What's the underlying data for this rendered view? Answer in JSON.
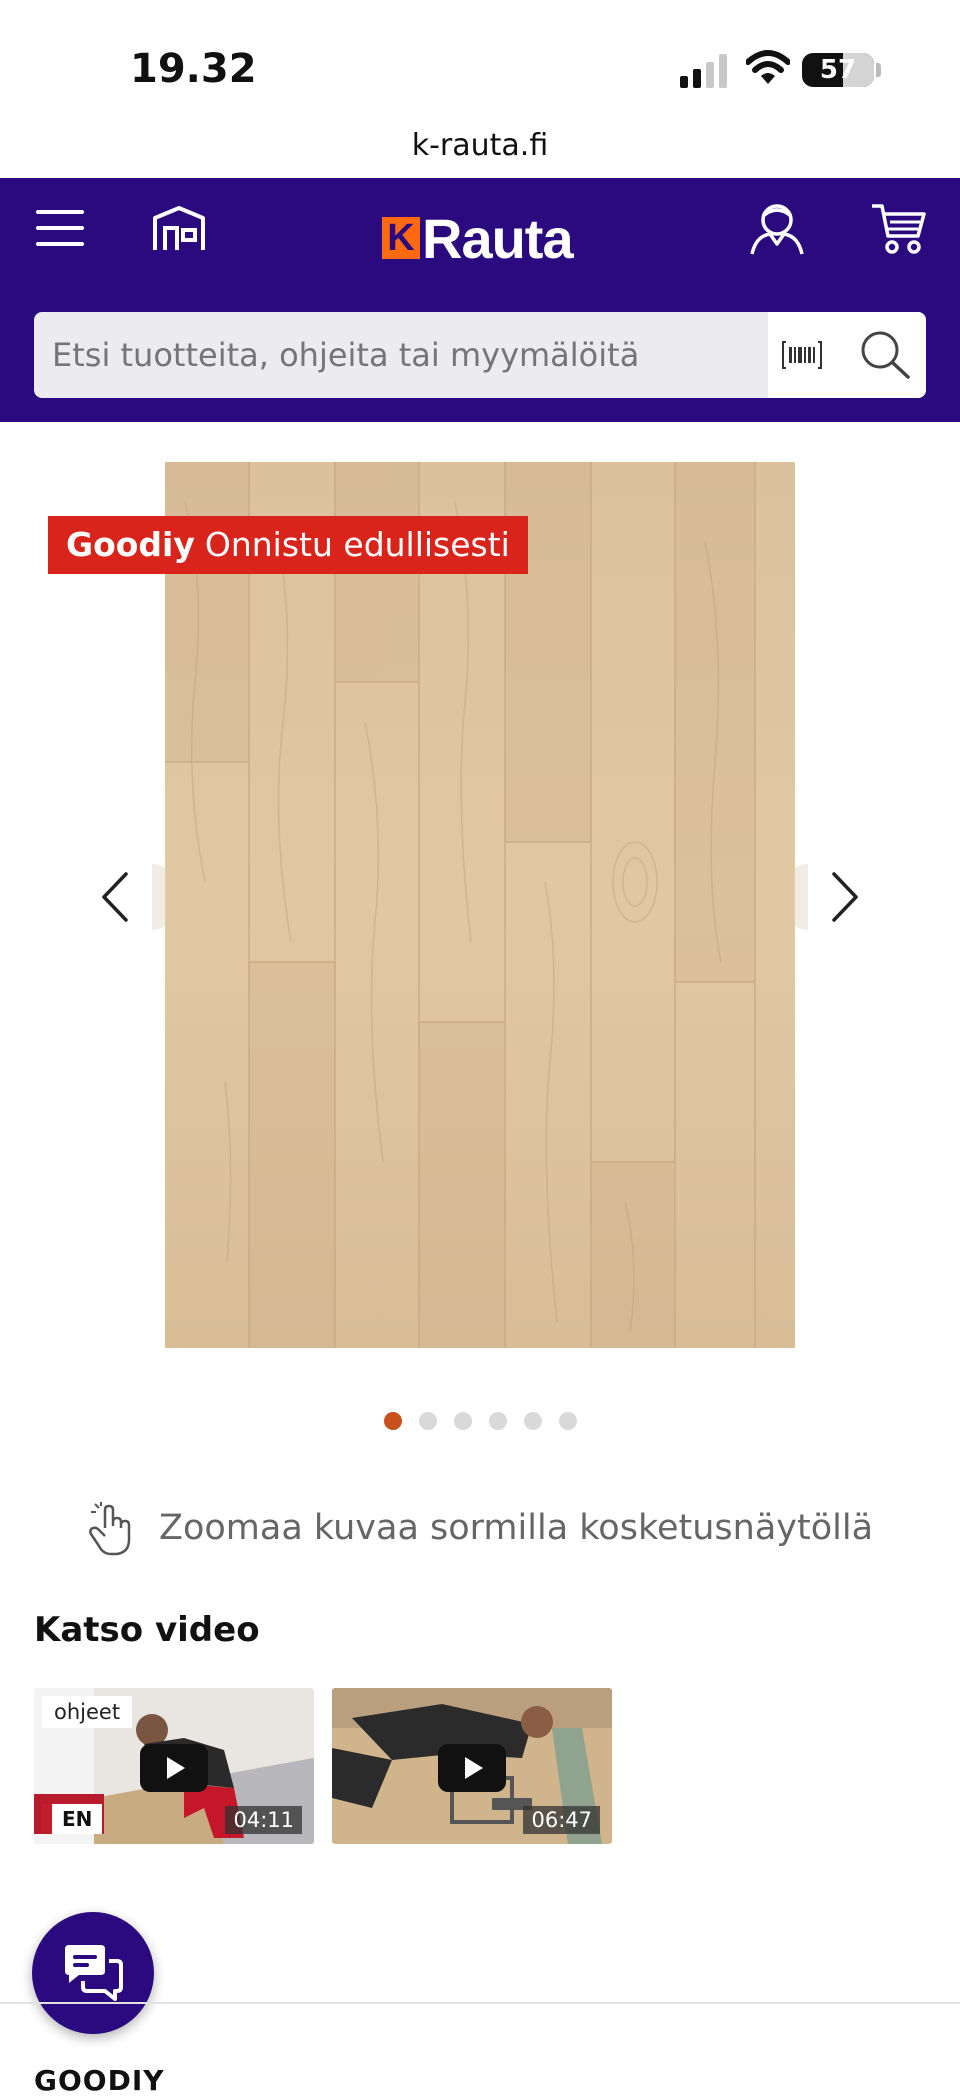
{
  "status_bar": {
    "time": "19.32",
    "battery": "57",
    "battery_level": 0.57
  },
  "browser": {
    "url": "k-rauta.fi"
  },
  "header": {
    "logo_k": "K",
    "logo_text": "Rauta",
    "menu_icon": "hamburger-menu-icon",
    "store_icon": "store-icon",
    "account_icon": "user-icon",
    "cart_icon": "cart-icon",
    "brand_color": "#2a0a7e",
    "accent_color": "#ff6a10"
  },
  "search": {
    "placeholder": "Etsi tuotteita, ohjeita tai myymälöitä",
    "value": "",
    "barcode_icon": "barcode-scan-icon",
    "search_icon": "search-icon"
  },
  "gallery": {
    "badge_brand": "Goodiy",
    "badge_text": "Onnistu edullisesti",
    "badge_color": "#d9241c",
    "image_count": 6,
    "active_index": 0,
    "prev_icon": "chevron-left-icon",
    "next_icon": "chevron-right-icon"
  },
  "zoom_hint": {
    "icon": "hand-touch-icon",
    "text": "Zoomaa kuvaa sormilla kosketusnäytöllä"
  },
  "videos": {
    "heading": "Katso video",
    "items": [
      {
        "tag": "ohjeet",
        "language": "EN",
        "duration": "04:11"
      },
      {
        "duration": "06:47"
      }
    ]
  },
  "chat": {
    "icon": "chat-bubbles-icon"
  },
  "footer": {
    "brand_heading": "GOODIY"
  }
}
